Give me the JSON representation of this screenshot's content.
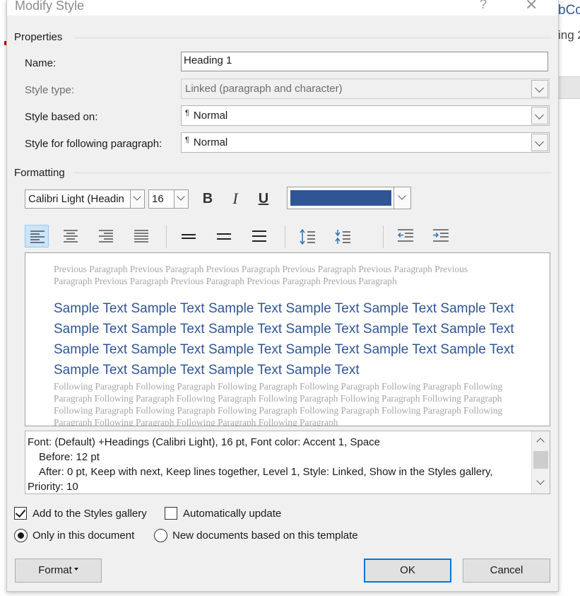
{
  "background": {
    "text_top": "bCc",
    "text_second": "ing 2"
  },
  "dialog": {
    "title": "Modify Style",
    "help_glyph": "?",
    "close_glyph": "✕"
  },
  "properties": {
    "heading": "Properties",
    "name_label": "Name:",
    "name_value": "Heading 1",
    "style_type_label": "Style type:",
    "style_type_value": "Linked (paragraph and character)",
    "based_on_label": "Style based on:",
    "based_on_value": "Normal",
    "following_label": "Style for following paragraph:",
    "following_value": "Normal",
    "paragraph_mark": "¶"
  },
  "formatting": {
    "heading": "Formatting",
    "font_name": "Calibri Light (Headin",
    "font_size": "16",
    "bold_label": "B",
    "italic_label": "I",
    "underline_label": "U",
    "font_color": "#2f5597"
  },
  "preview": {
    "previous_paragraph": "Previous Paragraph Previous Paragraph Previous Paragraph Previous Paragraph Previous Paragraph Previous Paragraph Previous Paragraph Previous Paragraph Previous Paragraph Previous Paragraph",
    "sample_text": "Sample Text Sample Text Sample Text Sample Text Sample Text Sample Text Sample Text Sample Text Sample Text Sample Text Sample Text Sample Text Sample Text Sample Text Sample Text Sample Text Sample Text Sample Text Sample Text Sample Text Sample Text Sample Text",
    "following_paragraph": "Following Paragraph Following Paragraph Following Paragraph Following Paragraph Following Paragraph Following Paragraph Following Paragraph Following Paragraph Following Paragraph Following Paragraph Following Paragraph Following Paragraph Following Paragraph Following Paragraph Following Paragraph Following Paragraph Following Paragraph Following Paragraph Following Paragraph Following Paragraph"
  },
  "description": {
    "line1": "Font: (Default) +Headings (Calibri Light), 16 pt, Font color: Accent 1, Space",
    "line2": "Before:  12 pt",
    "line3": "After:  0 pt, Keep with next, Keep lines together, Level 1, Style: Linked, Show in the Styles gallery,",
    "line4": "Priority: 10"
  },
  "options": {
    "add_to_gallery": "Add to the Styles gallery",
    "add_to_gallery_checked": true,
    "auto_update": "Automatically update",
    "auto_update_checked": false,
    "only_this_document": "Only in this document",
    "new_documents": "New documents based on this template",
    "selected_scope": "only_this_document"
  },
  "buttons": {
    "format": "Format",
    "ok": "OK",
    "cancel": "Cancel"
  }
}
